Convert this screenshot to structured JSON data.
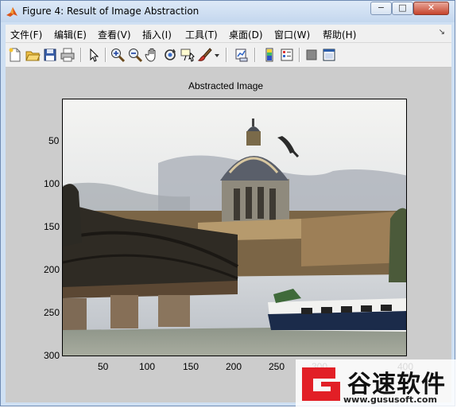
{
  "window": {
    "title": "Figure 4: Result of Image Abstraction"
  },
  "controls": {
    "minimize": "−",
    "maximize": "□",
    "close": "✕"
  },
  "menu": {
    "items": [
      "文件(F)",
      "编辑(E)",
      "查看(V)",
      "插入(I)",
      "工具(T)",
      "桌面(D)",
      "窗口(W)",
      "帮助(H)"
    ],
    "overflow": "↘"
  },
  "toolbar": {
    "buttons": [
      "new-figure-icon",
      "open-file-icon",
      "save-icon",
      "print-icon",
      "edit-plot-arrow-icon",
      "zoom-in-icon",
      "zoom-out-icon",
      "pan-hand-icon",
      "rotate-3d-icon",
      "data-cursor-icon",
      "brush-icon",
      "brush-dropdown-icon",
      "link-plot-icon",
      "insert-colorbar-icon",
      "insert-legend-icon",
      "hide-plot-tools-icon",
      "show-plot-tools-icon"
    ]
  },
  "figure": {
    "title": "Abstracted Image",
    "y_ticks": [
      "50",
      "100",
      "150",
      "200",
      "250",
      "300"
    ],
    "x_ticks": [
      "50",
      "100",
      "150",
      "200",
      "250",
      "300",
      "400"
    ]
  },
  "watermark": {
    "brand": "谷速软件",
    "url": "www.gususoft.com"
  }
}
